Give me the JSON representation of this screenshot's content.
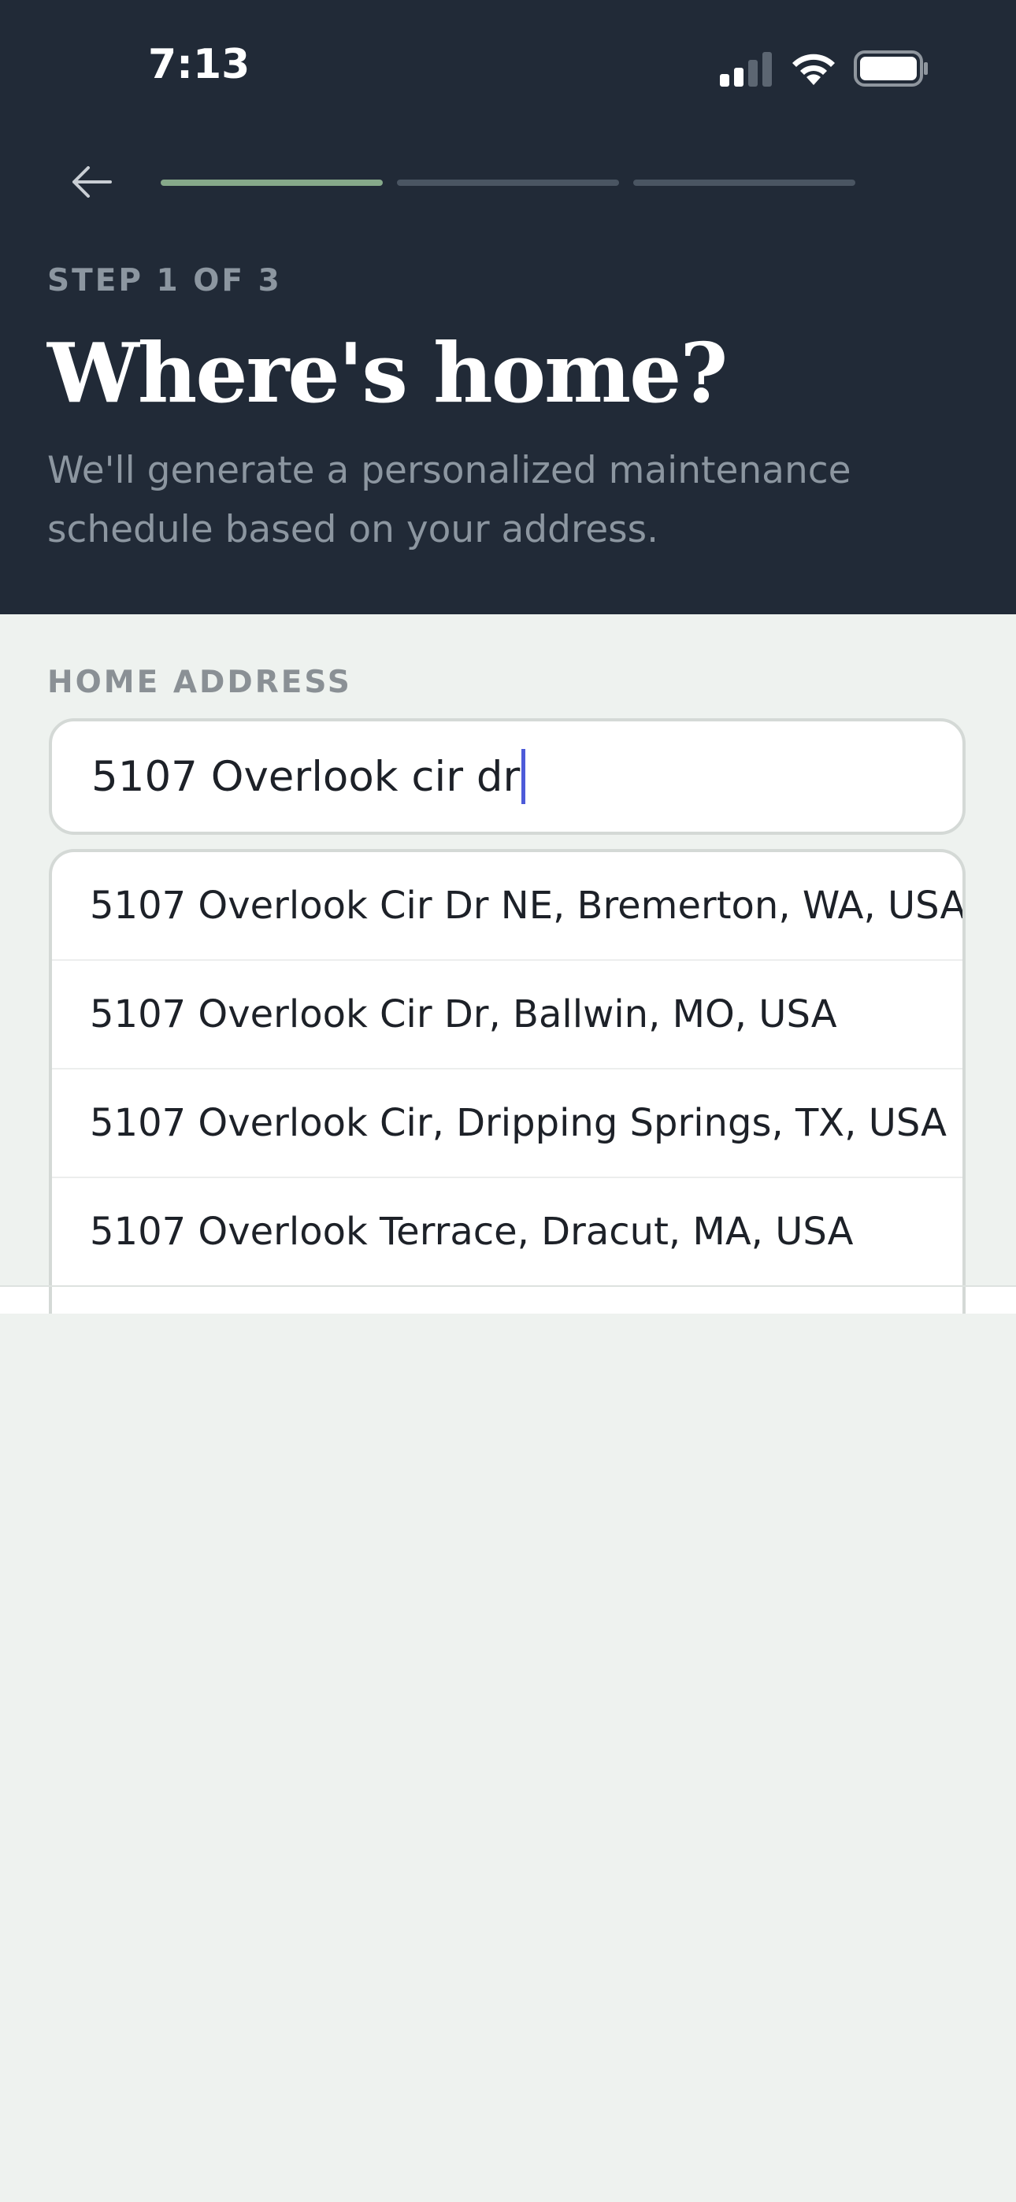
{
  "status_bar": {
    "time": "7:13",
    "signal_icon": "cellular-signal-icon",
    "wifi_icon": "wifi-icon",
    "battery_icon": "battery-icon"
  },
  "header": {
    "back_icon": "arrow-left-icon",
    "progress": {
      "total_steps": 3,
      "completed_steps": 1
    },
    "step_label": "STEP 1 OF 3",
    "title": "Where's home?",
    "subtitle": "We'll generate a personalized maintenance schedule based on your address."
  },
  "form": {
    "field_label": "HOME ADDRESS",
    "address_value": "5107 Overlook cir dr"
  },
  "suggestions": [
    "5107 Overlook Cir Dr NE, Bremerton, WA, USA",
    "5107 Overlook Cir Dr, Ballwin, MO, USA",
    "5107 Overlook Cir, Dripping Springs, TX, USA",
    "5107 Overlook Terrace, Dracut, MA, USA"
  ],
  "colors": {
    "header_bg": "#212a37",
    "page_bg": "#eef2ef",
    "progress_active": "#86a98a",
    "progress_inactive": "#4a5562",
    "caret": "#4d5bd9"
  }
}
